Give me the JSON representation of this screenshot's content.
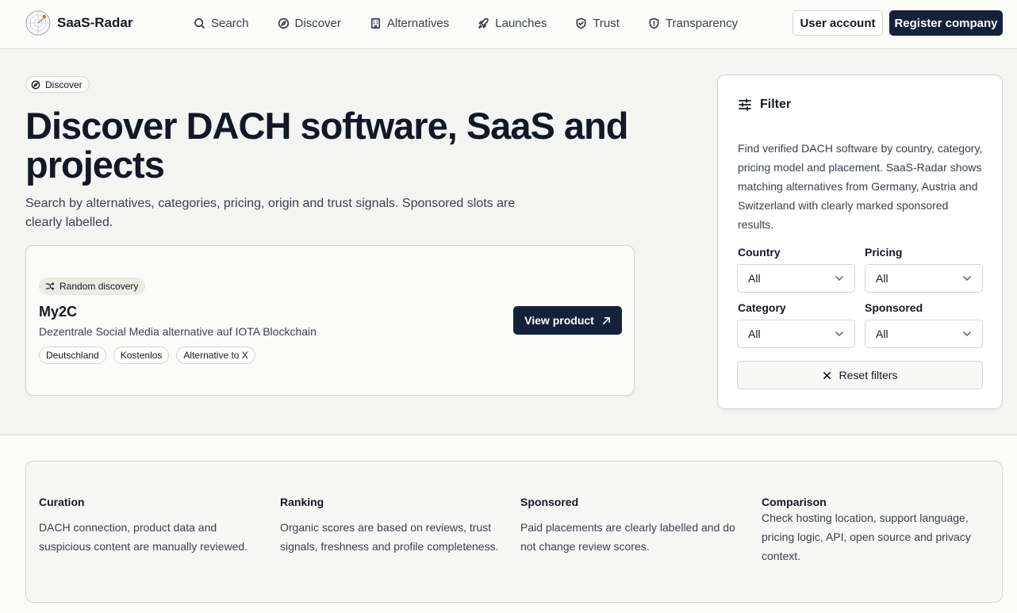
{
  "header": {
    "brand": "SaaS-Radar",
    "nav": [
      {
        "label": "Search",
        "icon": "search-icon"
      },
      {
        "label": "Discover",
        "icon": "compass-icon"
      },
      {
        "label": "Alternatives",
        "icon": "building-icon"
      },
      {
        "label": "Launches",
        "icon": "rocket-icon"
      },
      {
        "label": "Trust",
        "icon": "shield-check-icon"
      },
      {
        "label": "Transparency",
        "icon": "shield-icon"
      }
    ],
    "user_account": "User account",
    "register_company": "Register company"
  },
  "hero": {
    "badge": "Discover",
    "title": "Discover DACH software, SaaS and projects",
    "subtitle": "Search by alternatives, categories, pricing, origin and trust signals. Sponsored slots are clearly labelled."
  },
  "discovery": {
    "chip": "Random discovery",
    "name": "My2C",
    "description": "Dezentrale Social Media alternative auf IOTA Blockchain",
    "tags": [
      "Deutschland",
      "Kostenlos",
      "Alternative to X"
    ],
    "view_button": "View product"
  },
  "filter": {
    "title": "Filter",
    "description": "Find verified DACH software by country, category, pricing model and placement. SaaS-Radar shows matching alternatives from Germany, Austria and Switzerland with clearly marked sponsored results.",
    "country_label": "Country",
    "country_value": "All",
    "pricing_label": "Pricing",
    "pricing_value": "All",
    "category_label": "Category",
    "category_value": "All",
    "sponsored_label": "Sponsored",
    "sponsored_value": "All",
    "reset": "Reset filters"
  },
  "info": [
    {
      "title": "Curation",
      "text": "DACH connection, product data and suspicious content are manually reviewed."
    },
    {
      "title": "Ranking",
      "text": "Organic scores are based on reviews, trust signals, freshness and profile completeness."
    },
    {
      "title": "Sponsored",
      "text": "Paid placements are clearly labelled and do not change review scores."
    },
    {
      "title": "Comparison",
      "text": "Check hosting location, support language, pricing logic, API, open source and privacy context."
    }
  ],
  "colors": {
    "primary": "#14213a",
    "background": "#f4f5f3",
    "chip": "#ecebe2",
    "logo_accent": "#e0653a"
  }
}
